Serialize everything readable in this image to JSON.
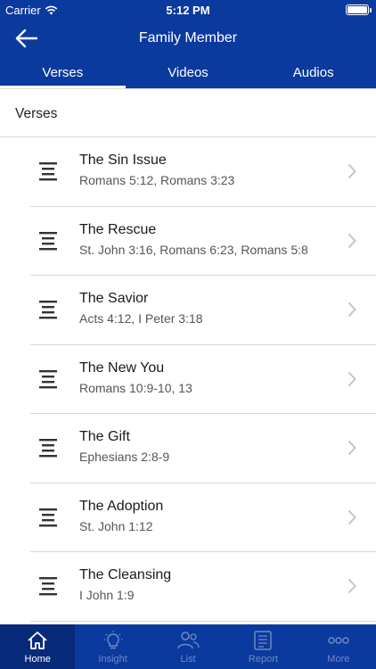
{
  "status_bar": {
    "carrier": "Carrier",
    "time": "5:12 PM"
  },
  "header": {
    "title": "Family Member"
  },
  "tabs": [
    {
      "label": "Verses",
      "active": true
    },
    {
      "label": "Videos",
      "active": false
    },
    {
      "label": "Audios",
      "active": false
    }
  ],
  "section": {
    "title": "Verses"
  },
  "items": [
    {
      "title": "The Sin Issue",
      "refs": "Romans 5:12, Romans 3:23"
    },
    {
      "title": "The Rescue",
      "refs": "St. John 3:16, Romans 6:23, Romans 5:8"
    },
    {
      "title": "The Savior",
      "refs": "Acts 4:12, I Peter 3:18"
    },
    {
      "title": "The New You",
      "refs": "Romans 10:9-10, 13"
    },
    {
      "title": "The Gift",
      "refs": "Ephesians 2:8-9"
    },
    {
      "title": "The Adoption",
      "refs": "St. John 1:12"
    },
    {
      "title": "The Cleansing",
      "refs": "I John 1:9"
    }
  ],
  "tab_bar": [
    {
      "label": "Home",
      "icon": "home-icon",
      "active": true
    },
    {
      "label": "Insight",
      "icon": "lightbulb-icon",
      "active": false
    },
    {
      "label": "List",
      "icon": "people-icon",
      "active": false
    },
    {
      "label": "Report",
      "icon": "report-icon",
      "active": false
    },
    {
      "label": "More",
      "icon": "more-icon",
      "active": false
    }
  ],
  "colors": {
    "brand": "#0b3a9e",
    "inactive_tab_label": "#6f89c7",
    "separator": "#d6d6d6"
  }
}
